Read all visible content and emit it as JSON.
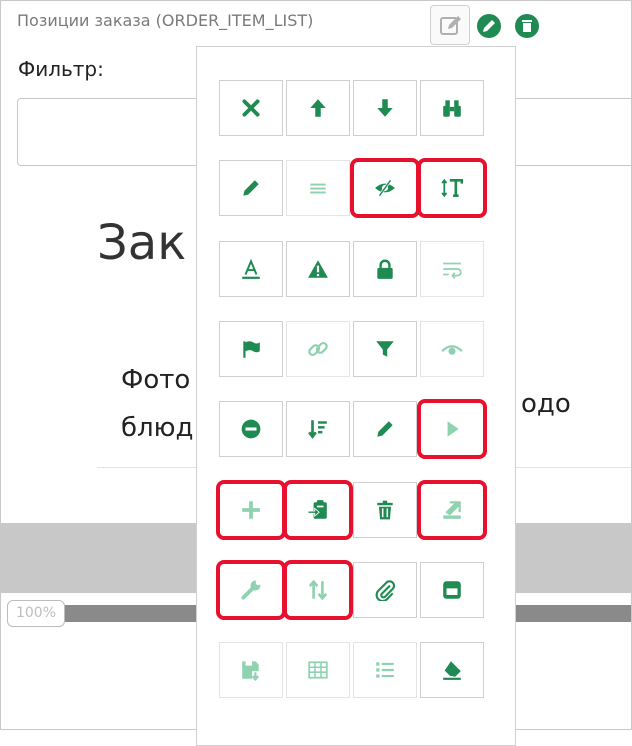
{
  "panel": {
    "title": "Позиции заказа (ORDER_ITEM_LIST)"
  },
  "filter": {
    "label": "Фильтр:",
    "value": ""
  },
  "content": {
    "title_fragment": "Зак",
    "col1_line1": "Фото",
    "col1_line2": "блюд",
    "col2_fragment": "одо"
  },
  "zoom": {
    "label": "100%"
  },
  "colors": {
    "accent": "#1f8a52",
    "accent_light": "#8fd2b0",
    "highlight": "#e8112d"
  },
  "toolbar": {
    "rows": [
      [
        {
          "icon": "close-icon",
          "enabled": true,
          "highlighted": false
        },
        {
          "icon": "arrow-up-icon",
          "enabled": true,
          "highlighted": false
        },
        {
          "icon": "arrow-down-icon",
          "enabled": true,
          "highlighted": false
        },
        {
          "icon": "binoculars-icon",
          "enabled": true,
          "highlighted": false
        }
      ],
      [
        {
          "icon": "pencil-icon",
          "enabled": true,
          "highlighted": false
        },
        {
          "icon": "list-icon",
          "enabled": false,
          "highlighted": false
        },
        {
          "icon": "eye-slash-icon",
          "enabled": true,
          "highlighted": true
        },
        {
          "icon": "text-height-icon",
          "enabled": true,
          "highlighted": true
        }
      ],
      [
        {
          "icon": "font-icon",
          "enabled": true,
          "highlighted": false
        },
        {
          "icon": "warning-icon",
          "enabled": true,
          "highlighted": false
        },
        {
          "icon": "lock-icon",
          "enabled": true,
          "highlighted": false
        },
        {
          "icon": "text-wrap-icon",
          "enabled": false,
          "highlighted": false
        }
      ],
      [
        {
          "icon": "flag-icon",
          "enabled": true,
          "highlighted": false
        },
        {
          "icon": "link-icon",
          "enabled": false,
          "highlighted": false
        },
        {
          "icon": "filter-icon",
          "enabled": true,
          "highlighted": false
        },
        {
          "icon": "eye-icon",
          "enabled": false,
          "highlighted": false
        }
      ],
      [
        {
          "icon": "minus-circle-icon",
          "enabled": true,
          "highlighted": false
        },
        {
          "icon": "sort-amount-icon",
          "enabled": true,
          "highlighted": false
        },
        {
          "icon": "pencil-icon",
          "enabled": true,
          "highlighted": false
        },
        {
          "icon": "play-icon",
          "enabled": false,
          "highlighted": true
        }
      ],
      [
        {
          "icon": "plus-icon",
          "enabled": false,
          "highlighted": true
        },
        {
          "icon": "paste-icon",
          "enabled": true,
          "highlighted": true
        },
        {
          "icon": "trash-icon",
          "enabled": true,
          "highlighted": false
        },
        {
          "icon": "export-icon",
          "enabled": false,
          "highlighted": true
        }
      ],
      [
        {
          "icon": "wrench-icon",
          "enabled": false,
          "highlighted": true
        },
        {
          "icon": "sort-icon",
          "enabled": false,
          "highlighted": true
        },
        {
          "icon": "paperclip-icon",
          "enabled": true,
          "highlighted": false
        },
        {
          "icon": "window-icon",
          "enabled": true,
          "highlighted": false
        }
      ],
      [
        {
          "icon": "save-icon",
          "enabled": false,
          "highlighted": false
        },
        {
          "icon": "table-icon",
          "enabled": false,
          "highlighted": false
        },
        {
          "icon": "list-ul-icon",
          "enabled": false,
          "highlighted": false
        },
        {
          "icon": "eraser-icon",
          "enabled": true,
          "highlighted": false
        }
      ]
    ]
  }
}
